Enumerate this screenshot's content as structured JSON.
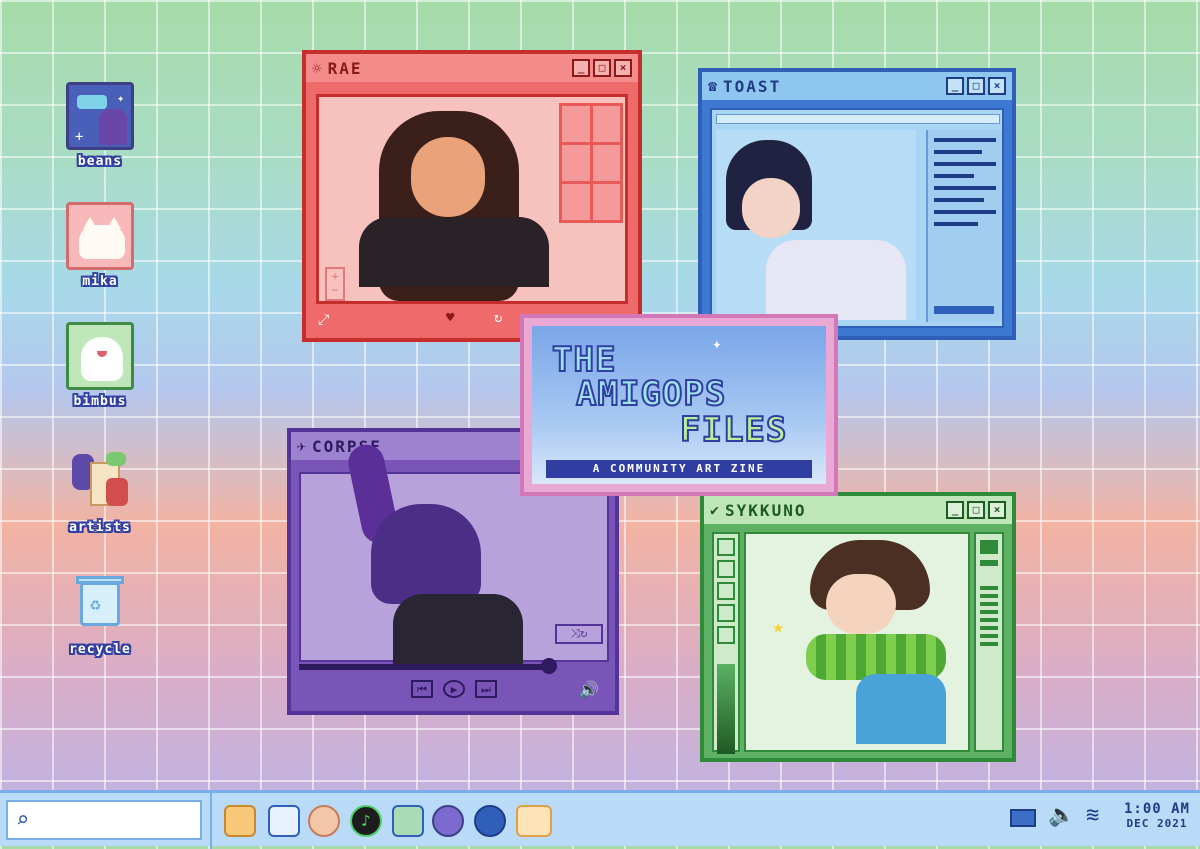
{
  "desktop": {
    "icons": [
      {
        "label": "beans",
        "icon": "beans-bunny-icon"
      },
      {
        "label": "mika",
        "icon": "white-cat-icon"
      },
      {
        "label": "bimbus",
        "icon": "bimbus-bird-icon"
      },
      {
        "label": "artists",
        "icon": "artists-folder-icon"
      },
      {
        "label": "recycle",
        "icon": "recycle-bin-icon"
      }
    ]
  },
  "windows": {
    "rae": {
      "title": "RAE",
      "icon": "sun-icon",
      "color": "#d83a3a"
    },
    "toast": {
      "title": "TOAST",
      "icon": "phone-icon",
      "color": "#2f5fb8"
    },
    "corpse": {
      "title": "CORPSE",
      "icon": "crow-icon",
      "color": "#6a45a8"
    },
    "sykkuno": {
      "title": "SYKKUNO",
      "icon": "check-icon",
      "color": "#2f8a3a"
    }
  },
  "zine": {
    "line1": "THE",
    "line2": "AMIGOPS",
    "line3": "FILES",
    "subtitle": "A COMMUNITY ART ZINE"
  },
  "taskbar": {
    "search_placeholder": "",
    "apps": [
      "folder-icon",
      "chat-list-icon",
      "paint-palette-icon",
      "music-icon",
      "image-viewer-icon",
      "messenger-icon",
      "game-controller-icon",
      "notes-icon"
    ],
    "tray": [
      "battery-icon",
      "volume-icon",
      "wifi-icon"
    ],
    "time": "1:00 AM",
    "date": "DEC 2021"
  }
}
